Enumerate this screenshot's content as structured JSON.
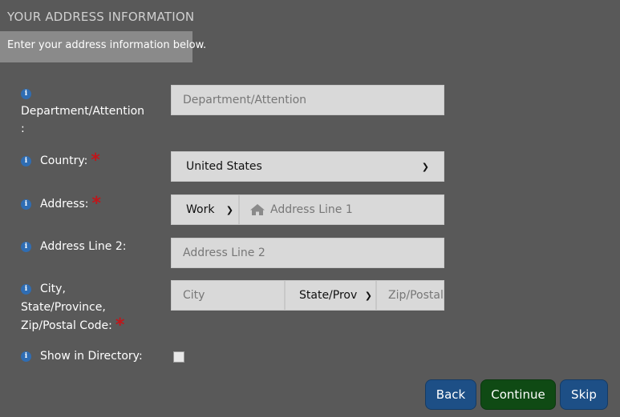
{
  "header": {
    "title": "YOUR ADDRESS INFORMATION"
  },
  "subtitle": "Enter your address information below.",
  "info_icon_glyph": "i",
  "required_marker": "*",
  "fields": {
    "department": {
      "label_line1": "Department/Attention",
      "label_line2": ":",
      "placeholder": "Department/Attention"
    },
    "country": {
      "label": "Country:",
      "value": "United States"
    },
    "address": {
      "label": "Address:",
      "type_value": "Work",
      "placeholder": "Address Line 1"
    },
    "address2": {
      "label": "Address Line 2:",
      "placeholder": "Address Line 2"
    },
    "city": {
      "label_line1": "City,",
      "label_line2": "State/Province,",
      "label_line3": "Zip/Postal Code:",
      "city_placeholder": "City",
      "state_value": "State/Province",
      "zip_placeholder": "Zip/Postal Code"
    },
    "directory": {
      "label": "Show in Directory:",
      "checked": false
    }
  },
  "buttons": {
    "back": "Back",
    "continue": "Continue",
    "skip": "Skip"
  },
  "colors": {
    "info": "#2f6db3",
    "required": "#c0161a",
    "back": "#1d4f86",
    "continue": "#0f4a14",
    "skip": "#1d4f86"
  }
}
